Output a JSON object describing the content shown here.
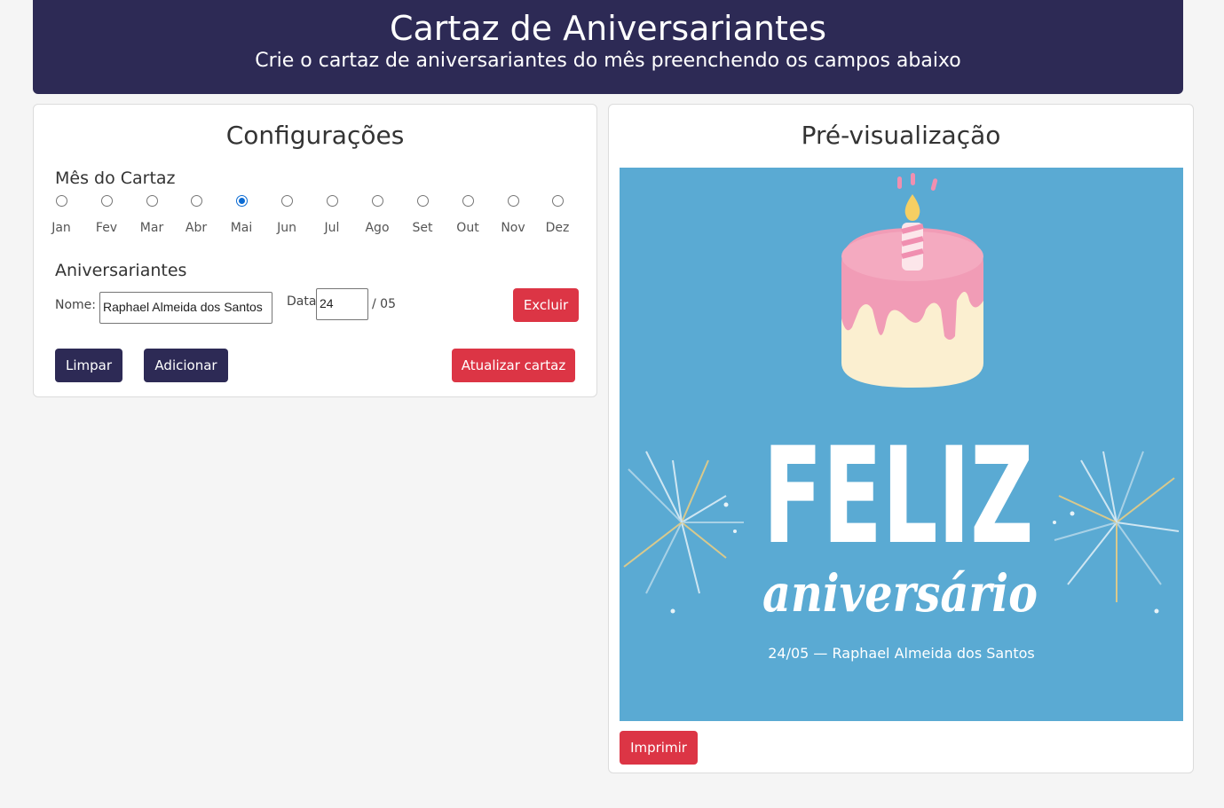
{
  "header": {
    "title": "Cartaz de Aniversariantes",
    "subtitle": "Crie o cartaz de aniversariantes do mês preenchendo os campos abaixo"
  },
  "config": {
    "title": "Configurações",
    "month_label": "Mês do Cartaz",
    "months": [
      "Jan",
      "Fev",
      "Mar",
      "Abr",
      "Mai",
      "Jun",
      "Jul",
      "Ago",
      "Set",
      "Out",
      "Nov",
      "Dez"
    ],
    "selected_month": "Mai",
    "birthdays_label": "Aniversariantes",
    "name_label": "Nome:",
    "name_value": "Raphael Almeida dos Santos",
    "date_label": "Data:",
    "day_value": "24",
    "month_suffix": "/ 05",
    "delete_button": "Excluir",
    "clear_button": "Limpar",
    "add_button": "Adicionar",
    "update_button": "Atualizar cartaz"
  },
  "preview": {
    "title": "Pré-visualização",
    "poster_title": "FELIZ",
    "poster_subtitle": "aniversário",
    "entry": "24/05 — Raphael Almeida dos Santos",
    "print_button": "Imprimir"
  },
  "colors": {
    "primary": "#2d2a55",
    "danger": "#dc3545",
    "poster_bg": "#5aaad3",
    "radio_selected": "#0b6bd3"
  }
}
